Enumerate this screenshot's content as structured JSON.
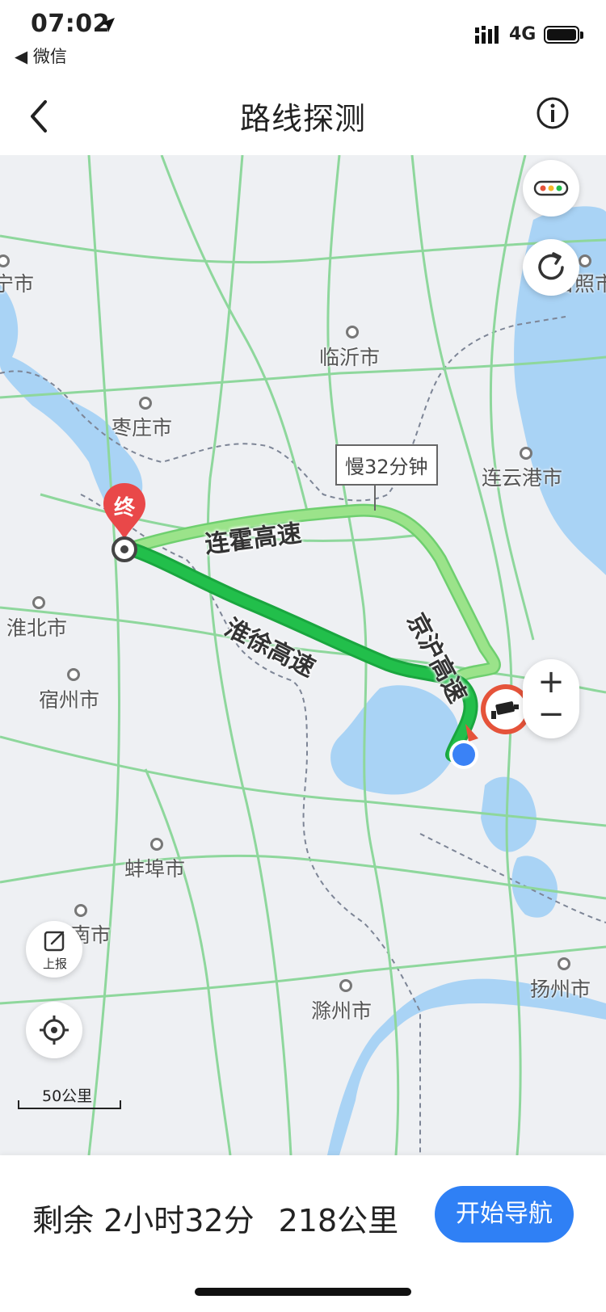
{
  "status": {
    "time": "07:02",
    "back_app": "◀ 微信",
    "network": "4G"
  },
  "nav": {
    "title": "路线探测"
  },
  "map": {
    "cities": [
      {
        "name": "宁市"
      },
      {
        "name": "日照市"
      },
      {
        "name": "临沂市"
      },
      {
        "name": "枣庄市"
      },
      {
        "name": "连云港市"
      },
      {
        "name": "淮北市"
      },
      {
        "name": "宿州市"
      },
      {
        "name": "蚌埠市"
      },
      {
        "name": "淮南市"
      },
      {
        "name": "滁州市"
      },
      {
        "name": "扬州市"
      }
    ],
    "roads": {
      "lianhuo": "连霍高速",
      "huaixu": "淮徐高速",
      "jinghu": "京沪高速"
    },
    "end_marker": "终",
    "callout": "慢32分钟",
    "report_label": "上报",
    "scale_label": "50公里",
    "zoom_in": "+",
    "zoom_out": "−",
    "colors": {
      "route_fast": "#1fb84a",
      "route_slow": "#8fe07a",
      "water": "#a9d3f5",
      "road": "#8ed79c"
    }
  },
  "panel": {
    "remaining": "剩余 2小时32分",
    "distance": "218公里",
    "start_button": "开始导航"
  }
}
